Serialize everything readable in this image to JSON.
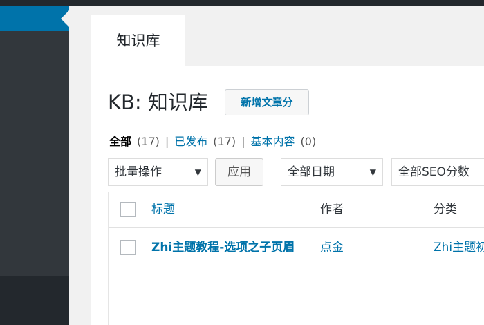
{
  "tab": {
    "label": "知识库"
  },
  "page": {
    "title": "KB: 知识库",
    "add_new_label": "新增文章分"
  },
  "views": {
    "all": {
      "label": "全部",
      "count": "(17)"
    },
    "published": {
      "label": "已发布",
      "count": "(17)"
    },
    "basic": {
      "label": "基本内容",
      "count": "(0)"
    },
    "separator": "|"
  },
  "filters": {
    "bulk_actions": "批量操作",
    "apply_label": "应用",
    "date_filter": "全部日期",
    "seo_filter": "全部SEO分数",
    "caret": "▼"
  },
  "table": {
    "columns": {
      "title": "标题",
      "author": "作者",
      "category": "分类"
    },
    "rows": [
      {
        "title": "Zhi主题教程-选项之子页眉",
        "author": "点金",
        "category": "Zhi主题初"
      }
    ]
  },
  "colors": {
    "admin_bar": "#23282d",
    "sidebar": "#32373c",
    "accent": "#0073aa",
    "background": "#f1f1f1"
  }
}
